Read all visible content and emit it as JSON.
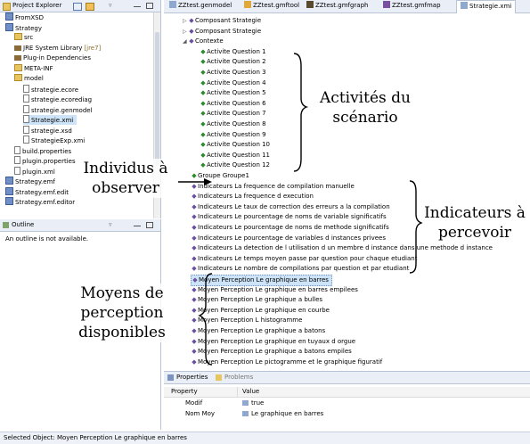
{
  "left_panel": {
    "title": "Project Explorer",
    "tree": [
      {
        "label": "FromXSD",
        "indent": 0
      },
      {
        "label": "Strategy",
        "indent": 0
      },
      {
        "label": "src",
        "indent": 1
      },
      {
        "label": "JRE System Library",
        "suffix": "[jre7]",
        "indent": 1
      },
      {
        "label": "Plug-in Dependencies",
        "indent": 1
      },
      {
        "label": "META-INF",
        "indent": 1
      },
      {
        "label": "model",
        "indent": 1
      },
      {
        "label": "strategie.ecore",
        "indent": 2
      },
      {
        "label": "strategie.ecorediag",
        "indent": 2
      },
      {
        "label": "strategie.genmodel",
        "indent": 2
      },
      {
        "label": "Strategie.xmi",
        "indent": 2
      },
      {
        "label": "strategie.xsd",
        "indent": 2
      },
      {
        "label": "StrategieExp.xmi",
        "indent": 2
      },
      {
        "label": "build.properties",
        "indent": 1
      },
      {
        "label": "plugin.properties",
        "indent": 1
      },
      {
        "label": "plugin.xml",
        "indent": 1
      },
      {
        "label": "Strategy.emf",
        "indent": 0
      },
      {
        "label": "Strategy.emf.edit",
        "indent": 0
      },
      {
        "label": "Strategy.emf.editor",
        "indent": 0
      }
    ]
  },
  "outline_panel": {
    "title": "Outline",
    "message": "An outline is not available."
  },
  "editor_tabs": [
    {
      "label": "ZZtest.genmodel",
      "active": false
    },
    {
      "label": "ZZtest.gmftool",
      "active": false
    },
    {
      "label": "ZZtest.gmfgraph",
      "active": false
    },
    {
      "label": "ZZtest.gmfmap",
      "active": false
    },
    {
      "label": "Strategie.xmi",
      "active": true
    }
  ],
  "editor_tree": [
    {
      "label": "Composant Strategie",
      "indent": 1,
      "icon": "purple",
      "arrow": "right"
    },
    {
      "label": "Composant Strategie",
      "indent": 1,
      "icon": "purple",
      "arrow": "right"
    },
    {
      "label": "Contexte",
      "indent": 1,
      "icon": "purple",
      "arrow": "down"
    },
    {
      "label": "Activite Question 1",
      "indent": 2,
      "icon": "green"
    },
    {
      "label": "Activite Question 2",
      "indent": 2,
      "icon": "green"
    },
    {
      "label": "Activite Question 3",
      "indent": 2,
      "icon": "green"
    },
    {
      "label": "Activite Question 4",
      "indent": 2,
      "icon": "green"
    },
    {
      "label": "Activite Question 5",
      "indent": 2,
      "icon": "green"
    },
    {
      "label": "Activite Question 6",
      "indent": 2,
      "icon": "green"
    },
    {
      "label": "Activite Question 7",
      "indent": 2,
      "icon": "green"
    },
    {
      "label": "Activite Question 8",
      "indent": 2,
      "icon": "green"
    },
    {
      "label": "Activite Question 9",
      "indent": 2,
      "icon": "green"
    },
    {
      "label": "Activite Question 10",
      "indent": 2,
      "icon": "green"
    },
    {
      "label": "Activite Question 11",
      "indent": 2,
      "icon": "green"
    },
    {
      "label": "Activite Question 12",
      "indent": 2,
      "icon": "green"
    },
    {
      "label": "Groupe Groupe1",
      "indent": 1,
      "icon": "green"
    },
    {
      "label": "Indicateurs La frequence de compilation manuelle",
      "indent": 1,
      "icon": "purple"
    },
    {
      "label": "Indicateurs La frequence d execution",
      "indent": 1,
      "icon": "purple"
    },
    {
      "label": "Indicateurs Le taux de correction des erreurs a la compilation",
      "indent": 1,
      "icon": "purple"
    },
    {
      "label": "Indicateurs Le pourcentage de noms de variable significatifs",
      "indent": 1,
      "icon": "purple"
    },
    {
      "label": "Indicateurs Le pourcentage de noms de methode significatifs",
      "indent": 1,
      "icon": "purple"
    },
    {
      "label": "Indicateurs Le pourcentage de variables d instances privees",
      "indent": 1,
      "icon": "purple"
    },
    {
      "label": "Indicateurs La detection de l utilisation d un membre d instance dans une methode d instance",
      "indent": 1,
      "icon": "purple"
    },
    {
      "label": "Indicateurs Le temps moyen passe par question pour chaque etudiant",
      "indent": 1,
      "icon": "purple"
    },
    {
      "label": "Indicateurs Le nombre de compilations par question et par etudiant",
      "indent": 1,
      "icon": "purple"
    },
    {
      "label": "Moyen Perception Le graphique en barres",
      "indent": 1,
      "icon": "purple",
      "selected": true
    },
    {
      "label": "Moyen Perception Le graphique en barres empilees",
      "indent": 1,
      "icon": "purple"
    },
    {
      "label": "Moyen Perception Le graphique a bulles",
      "indent": 1,
      "icon": "purple"
    },
    {
      "label": "Moyen Perception Le graphique en courbe",
      "indent": 1,
      "icon": "purple"
    },
    {
      "label": "Moyen Perception L histogramme",
      "indent": 1,
      "icon": "purple"
    },
    {
      "label": "Moyen Perception Le graphique a batons",
      "indent": 1,
      "icon": "purple"
    },
    {
      "label": "Moyen Perception Le graphique en tuyaux d orgue",
      "indent": 1,
      "icon": "purple"
    },
    {
      "label": "Moyen Perception Le graphique a batons empiles",
      "indent": 1,
      "icon": "purple"
    },
    {
      "label": "Moyen Perception Le pictogramme et le graphique figuratif",
      "indent": 1,
      "icon": "purple"
    }
  ],
  "properties_panel": {
    "tabs": [
      "Properties",
      "Problems"
    ],
    "columns": [
      "Property",
      "Value"
    ],
    "rows": [
      {
        "property": "Modif",
        "value": "true"
      },
      {
        "property": "Nom Moy",
        "value": "Le graphique en barres"
      }
    ]
  },
  "status_bar": "Selected Object: Moyen Perception Le graphique en barres",
  "annotations": {
    "activites": [
      "Activités du",
      "scénario"
    ],
    "individus": [
      "Individus à",
      "observer"
    ],
    "indicateurs": [
      "Indicateurs à",
      "percevoir"
    ],
    "moyens": [
      "Moyens de",
      "perception",
      "disponibles"
    ]
  },
  "colors": {
    "panel_header": "#e9eef7",
    "selection": "#cde3f7",
    "activity_icon": "#2d8a2d",
    "indicator_icon": "#6b4fa0"
  }
}
